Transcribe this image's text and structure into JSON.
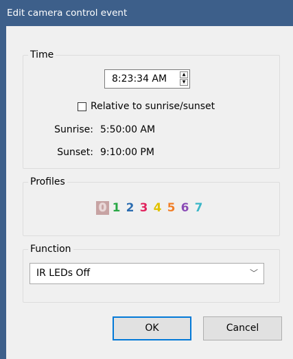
{
  "window": {
    "title": "Edit camera control event"
  },
  "time_group": {
    "label": "Time",
    "time_value": "8:23:34 AM",
    "relative_label": "Relative to sunrise/sunset",
    "relative_checked": false,
    "sunrise_label": "Sunrise:",
    "sunrise_value": "5:50:00 AM",
    "sunset_label": "Sunset:",
    "sunset_value": "9:10:00 PM"
  },
  "profiles_group": {
    "label": "Profiles",
    "items": [
      {
        "label": "0",
        "color": "#e9d8d8",
        "selected": true
      },
      {
        "label": "1",
        "color": "#28a745",
        "selected": false
      },
      {
        "label": "2",
        "color": "#2b6cb0",
        "selected": false
      },
      {
        "label": "3",
        "color": "#e0245e",
        "selected": false
      },
      {
        "label": "4",
        "color": "#e0c200",
        "selected": false
      },
      {
        "label": "5",
        "color": "#f07f2a",
        "selected": false
      },
      {
        "label": "6",
        "color": "#8a4bb5",
        "selected": false
      },
      {
        "label": "7",
        "color": "#3cb6c7",
        "selected": false
      }
    ]
  },
  "function_group": {
    "label": "Function",
    "selected_value": "IR LEDs Off"
  },
  "buttons": {
    "ok_label": "OK",
    "cancel_label": "Cancel"
  },
  "icons": {
    "spin_up": "triangle-up-icon",
    "spin_down": "triangle-down-icon",
    "dropdown": "chevron-down-icon"
  }
}
